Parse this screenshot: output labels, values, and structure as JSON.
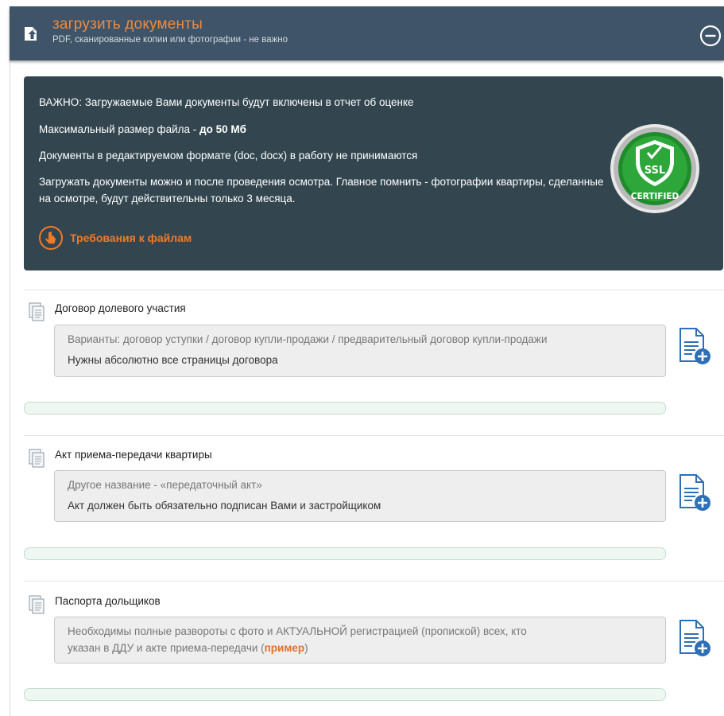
{
  "header": {
    "title": "загрузить документы",
    "subtitle": "PDF, сканированные копии или фотографии - не важно"
  },
  "info": {
    "line1": "ВАЖНО: Загружаемые Вами документы будут включены в отчет об оценке",
    "line2_prefix": "Максимальный размер файла - ",
    "line2_bold": "до 50 Мб",
    "line3": "Документы в редактируемом формате (doc, docx) в работу не принимаются",
    "line4": "Загружать документы можно и после проведения осмотра. Главное помнить - фотографии квартиры, сделанные на осмотре, будут действительны только 3 месяца.",
    "requirements_link": "Требования к файлам",
    "badge_text": "SSL",
    "badge_caption": "CERTIFIED"
  },
  "sections": [
    {
      "title": "Договор долевого участия",
      "hint": "Варианты: договор уступки / договор купли-продажи / предварительный договор купли-продажи",
      "note": "Нужны абсолютно все страницы договора",
      "progress": 0
    },
    {
      "title": "Акт приема-передачи квартиры",
      "hint": "Другое название - «передаточный акт»",
      "note": "Акт должен быть обязательно подписан Вами и застройщиком",
      "progress": 0
    },
    {
      "title": "Паспорта дольщиков",
      "hint_line1": "Необходимы полные развороты с фото и АКТУАЛЬНОЙ регистрацией (пропиской) всех, кто",
      "hint_line2_prefix": "указан в ДДУ и акте приема-передачи (",
      "example_link": "пример",
      "hint_line2_suffix": ")",
      "progress": 0
    }
  ],
  "colors": {
    "header_bg": "#3f5468",
    "accent_orange": "#ef8a3f",
    "info_bg": "#33464f",
    "progress_bg": "#eef7f2",
    "icon_blue": "#2f6fb7"
  }
}
